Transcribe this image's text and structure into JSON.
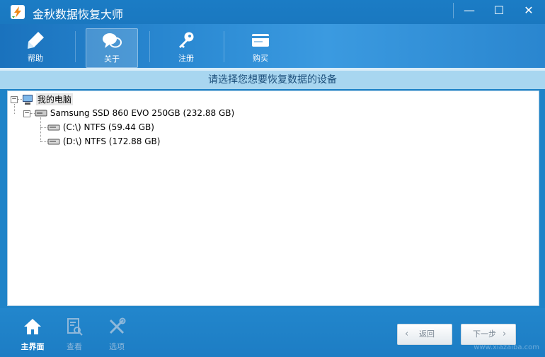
{
  "window": {
    "title": "金秋数据恢复大师",
    "min_glyph": "—",
    "max_glyph": "☐",
    "close_glyph": "✕"
  },
  "toolbar": {
    "items": [
      {
        "label": "帮助",
        "icon": "pen-icon"
      },
      {
        "label": "关于",
        "icon": "chat-bubbles-icon",
        "active": true
      },
      {
        "label": "注册",
        "icon": "key-icon"
      },
      {
        "label": "购买",
        "icon": "card-icon"
      }
    ]
  },
  "prompt": "请选择您想要恢复数据的设备",
  "tree": {
    "root": {
      "label": "我的电脑",
      "icon": "computer-icon"
    },
    "disk": {
      "label": "Samsung SSD 860 EVO 250GB (232.88 GB)",
      "icon": "hard-drive-icon"
    },
    "partitions": [
      {
        "label": "(C:\\) NTFS (59.44 GB)",
        "icon": "partition-icon"
      },
      {
        "label": "(D:\\) NTFS (172.88 GB)",
        "icon": "partition-icon"
      }
    ]
  },
  "bottom": {
    "items": [
      {
        "label": "主界面",
        "icon": "home-icon",
        "enabled": true
      },
      {
        "label": "查看",
        "icon": "document-search-icon",
        "enabled": false
      },
      {
        "label": "选项",
        "icon": "tools-icon",
        "enabled": false
      }
    ],
    "back_label": "返回",
    "next_label": "下一步"
  },
  "watermark": "www.xiazaiba.com",
  "colors": {
    "title_bar": "#1b7cc5",
    "prompt_bg": "#a8d6f0",
    "bottom_bar": "#1f81c8"
  }
}
